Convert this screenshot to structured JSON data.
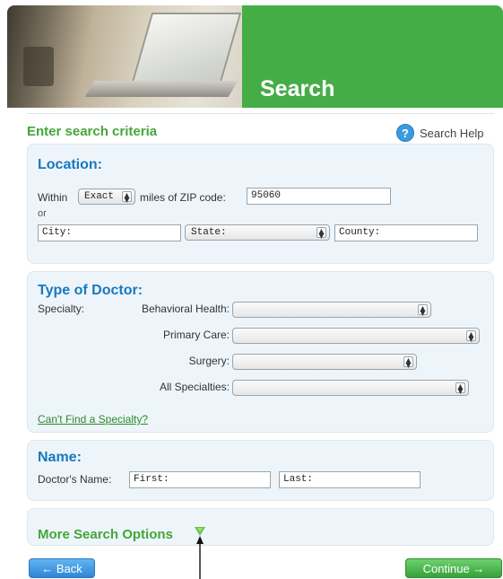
{
  "banner": {
    "title": "Search"
  },
  "criteria": {
    "title": "Enter search criteria",
    "help_label": "Search Help",
    "help_icon": "?"
  },
  "location": {
    "title": "Location:",
    "within_label": "Within",
    "distance_select": "Exact",
    "miles_label": "miles of ZIP code:",
    "zip_value": "95060",
    "or_label": "or",
    "city_placeholder": "City:",
    "state_select": "State:",
    "county_placeholder": "County:"
  },
  "doctor_type": {
    "title": "Type of Doctor:",
    "specialty_label": "Specialty:",
    "rows": [
      {
        "label": "Behavioral Health:",
        "value": ""
      },
      {
        "label": "Primary Care:",
        "value": ""
      },
      {
        "label": "Surgery:",
        "value": ""
      },
      {
        "label": "All Specialties:",
        "value": ""
      }
    ],
    "cant_find_link": "Can't Find a Specialty?"
  },
  "name": {
    "title": "Name:",
    "doctor_name_label": "Doctor's Name:",
    "first_placeholder": "First:",
    "last_placeholder": "Last:"
  },
  "more_options": {
    "label": "More Search Options"
  },
  "buttons": {
    "back": "← Back",
    "continue": "Continue →"
  },
  "colors": {
    "brand_green": "#44ad46",
    "title_blue": "#1779c0",
    "panel_bg": "#eef5fa"
  }
}
